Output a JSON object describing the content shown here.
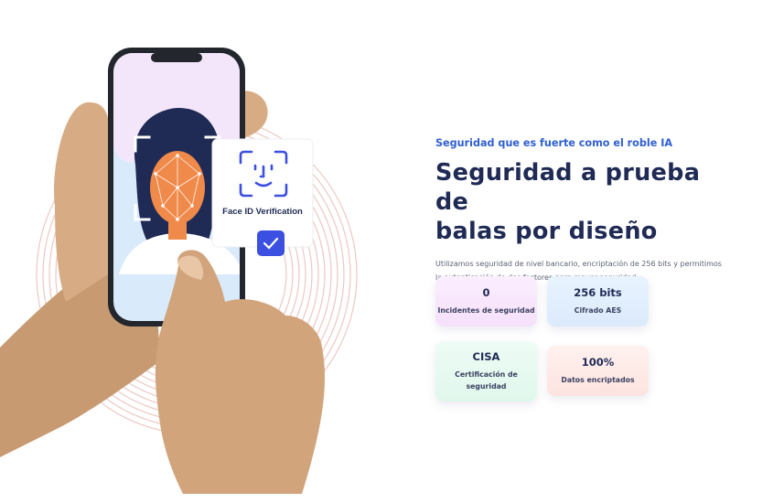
{
  "illustration": {
    "faceid_label": "Face ID Verification"
  },
  "section": {
    "eyebrow": "Seguridad que es fuerte como el roble IA",
    "headline_line1": "Seguridad a prueba de",
    "headline_line2": "balas por diseño",
    "description": "Utilizamos seguridad de nivel bancario, encriptación de 256 bits y permitimos la autenticación de dos factores para mayor seguridad"
  },
  "stats": [
    {
      "value": "0",
      "label_line1": "Incidentes de seguridad",
      "label_line2": ""
    },
    {
      "value": "256 bits",
      "label_line1": "Cifrado AES",
      "label_line2": ""
    },
    {
      "value": "CISA",
      "label_line1": "Certificación de",
      "label_line2": "seguridad"
    },
    {
      "value": "100%",
      "label_line1": "Datos encriptados",
      "label_line2": ""
    }
  ],
  "colors": {
    "accent_blue": "#2f5fd0",
    "headline_navy": "#1f2a55",
    "faceid_blue": "#3b4fe0",
    "face_orange": "#f08a4b"
  }
}
